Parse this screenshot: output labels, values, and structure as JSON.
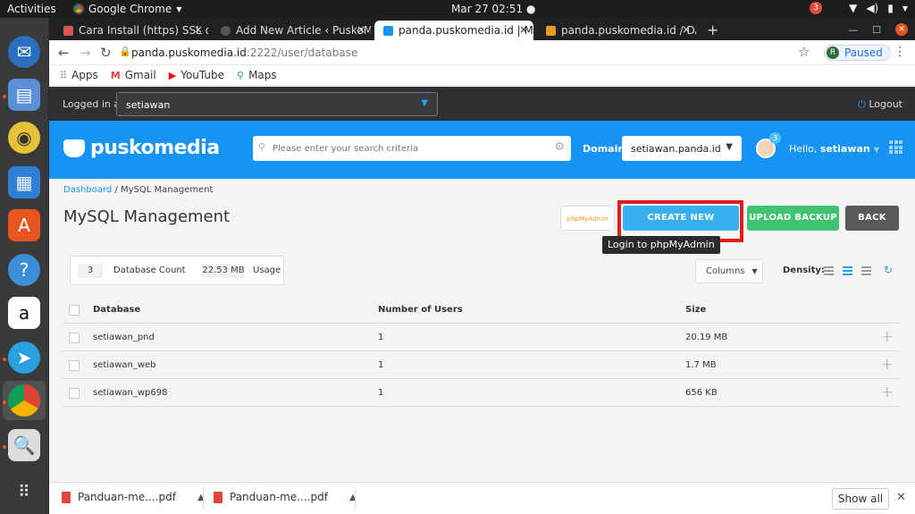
{
  "system": {
    "activities": "Activities",
    "app_name": "Google Chrome",
    "clock": "Mar 27  02:51",
    "notif_count": "3"
  },
  "tabs": [
    {
      "title": "Cara Install (https) SSL di",
      "close": "×"
    },
    {
      "title": "Add New Article ‹ PuskoM",
      "close": "×"
    },
    {
      "title": "panda.puskomedia.id | My",
      "close": "×"
    },
    {
      "title": "panda.puskomedia.id / DA",
      "close": "×"
    }
  ],
  "newtab": "+",
  "address": {
    "host": "panda.puskomedia.id",
    "path": ":2222/user/database",
    "profile_initial": "R",
    "profile_status": "Paused"
  },
  "bookmarks": [
    {
      "label": "Apps",
      "icon": "apps-grid-icon"
    },
    {
      "label": "Gmail",
      "icon": "gmail-icon"
    },
    {
      "label": "YouTube",
      "icon": "youtube-icon"
    },
    {
      "label": "Maps",
      "icon": "maps-icon"
    }
  ],
  "loggedbar": {
    "label": "Logged in as",
    "user": "setiawan",
    "logout": "Logout"
  },
  "header": {
    "logo": "puskomedia",
    "search_placeholder": "Please enter your search criteria",
    "domain_label": "Domain",
    "domain_value": "setiawan.panda.id",
    "user_badge": "3",
    "hello": "Hello,",
    "username": "setiawan"
  },
  "breadcrumb": {
    "link": "Dashboard",
    "current": " / MySQL Management"
  },
  "page_title": "MySQL Management",
  "buttons": {
    "phpmyadmin": "phpMyAdmin",
    "create": "CREATE NEW DATABASE",
    "upload": "UPLOAD BACKUP",
    "back": "BACK"
  },
  "tooltip": "Login to phpMyAdmin",
  "stats": {
    "db_count": "3",
    "db_count_label": "Database Count",
    "usage_value": "22.53 MB",
    "usage_label": "Usage"
  },
  "toolbar": {
    "columns": "Columns",
    "density": "Density:"
  },
  "table": {
    "headers": [
      "Database",
      "Number of Users",
      "Size"
    ],
    "rows": [
      {
        "name": "setiawan_pnd",
        "users": "1",
        "size": "20.19 MB"
      },
      {
        "name": "setiawan_web",
        "users": "1",
        "size": "1.7 MB"
      },
      {
        "name": "setiawan_wp698",
        "users": "1",
        "size": "656 KB"
      }
    ]
  },
  "downloads": [
    {
      "name": "Panduan-me....pdf"
    },
    {
      "name": "Panduan-me....pdf"
    }
  ],
  "show_all": "Show all",
  "colors": {
    "brand_blue": "#1693f3",
    "create_btn": "#36b0f0",
    "upload_btn": "#41c472",
    "back_btn": "#58595b",
    "highlight": "#e21d1d"
  }
}
